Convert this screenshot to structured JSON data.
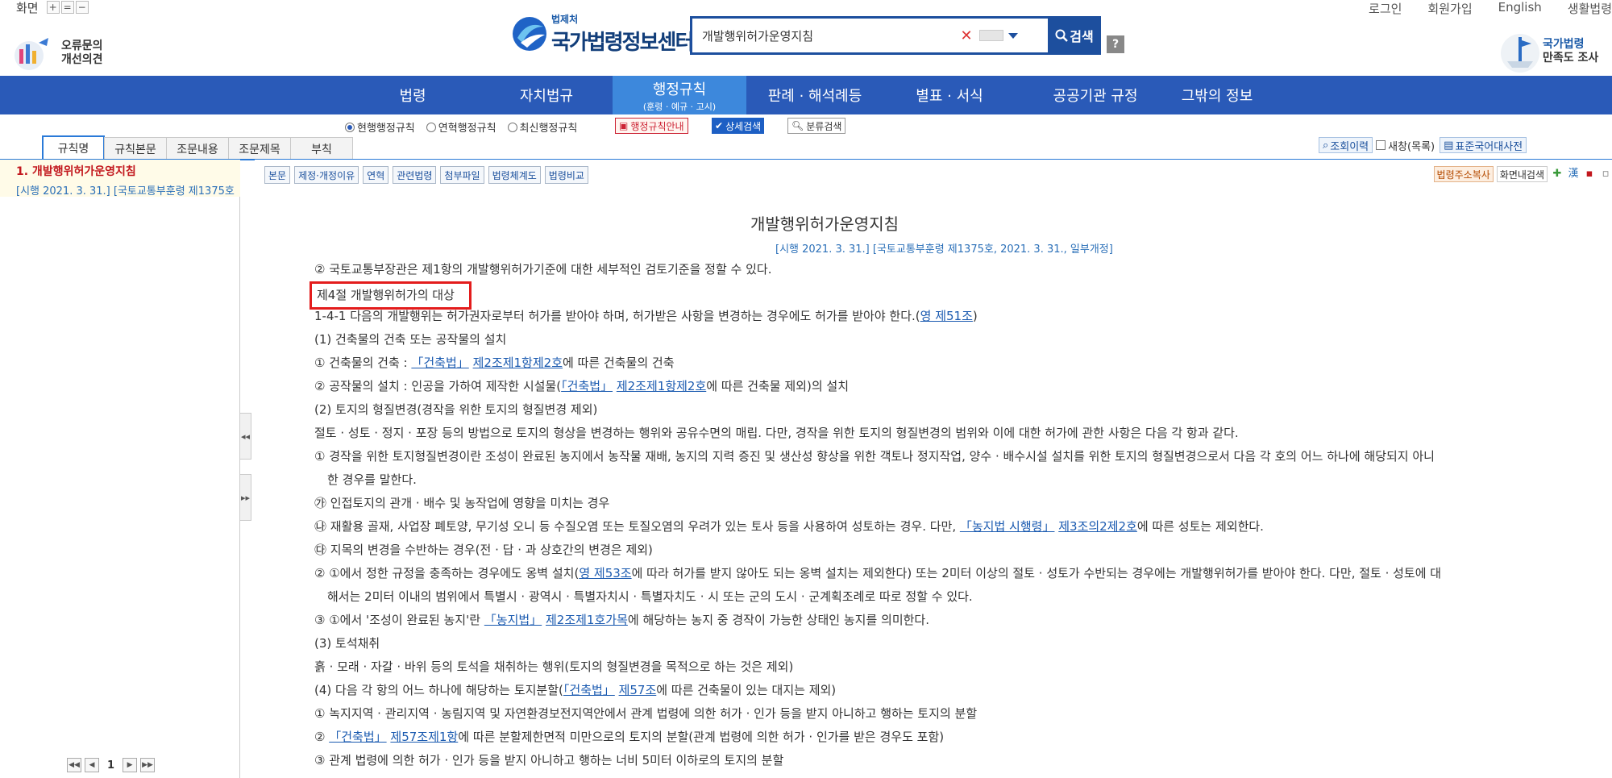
{
  "top": {
    "zoom_label": "화면",
    "zoom_plus": "+",
    "zoom_reset": "=",
    "zoom_minus": "−",
    "feedback_line1": "오류문의",
    "feedback_line2": "개선의견",
    "brand_sub": "법제처",
    "brand_main": "국가법령정보센터",
    "search_value": "개발행위허가운영지침",
    "search_button": "검색",
    "help": "?",
    "links": [
      "로그인",
      "회원가입",
      "English",
      "생활법령"
    ],
    "survey_line1": "국가법령",
    "survey_line2": "만족도 조사"
  },
  "nav": {
    "items": [
      "법령",
      "자치법규",
      "행정규칙",
      "판례 · 해석례등",
      "별표 · 서식",
      "공공기관 규정",
      "그밖의 정보"
    ],
    "active_sub": "(훈령 · 예규 · 고시)"
  },
  "subbar": {
    "radios": [
      "현행행정규칙",
      "연혁행정규칙",
      "최신행정규칙"
    ],
    "selected_radio": "현행행정규칙",
    "guide_button": "행정규칙안내",
    "detail_search": "상세검색",
    "category_search": "분류검색",
    "left_tabs": [
      "규칙명",
      "규칙본문",
      "조문내용",
      "조문제목",
      "부칙"
    ],
    "history": "조회이력",
    "new_window": "새창(목록)",
    "dictionary": "표준국어대사전"
  },
  "left": {
    "item_title": "1. 개발행위허가운영지침",
    "item_meta": "[시행 2021. 3. 31.] [국토교통부훈령 제1375호",
    "page": "1"
  },
  "toolbar": {
    "buttons": [
      "본문",
      "제정·개정이유",
      "연혁",
      "관련법령",
      "첨부파일",
      "법령체계도",
      "법령비교"
    ],
    "copy_address": "법령주소복사",
    "in_page_search": "화면내검색"
  },
  "doc": {
    "title": "개발행위허가운영지침",
    "meta": "[시행 2021. 3. 31.] [국토교통부훈령 제1375호, 2021. 3. 31., 일부개정]",
    "l01": "② 국토교통부장관은 제1항의 개발행위허가기준에 대한 세부적인 검토기준을 정할 수 있다.",
    "l02": "제4절 개발행위허가의 대상",
    "l03a": "1-4-1 다음의 개발행위는 허가권자로부터 허가를 받아야 하며, 허가받은 사항을 변경하는 경우에도 허가를 받아야 한다.(",
    "l03link": "영 제51조",
    "l03b": ")",
    "l04": "(1) 건축물의 건축 또는 공작물의 설치",
    "l05a": "① 건축물의 건축 : ",
    "l05link1": "「건축법」",
    "l05link2": "제2조제1항제2호",
    "l05b": "에 따른 건축물의 건축",
    "l06a": "② 공작물의 설치 : 인공을 가하여 제작한 시설물(",
    "l06link1": "「건축법」",
    "l06link2": "제2조제1항제2호",
    "l06b": "에 따른 건축물 제외)의 설치",
    "l07": "(2) 토지의 형질변경(경작을 위한 토지의 형질변경 제외)",
    "l08": "절토 · 성토 · 정지 · 포장 등의 방법으로 토지의 형상을 변경하는 행위와 공유수면의 매립. 다만, 경작을 위한 토지의 형질변경의 범위와 이에 대한 허가에 관한 사항은 다음 각 항과 같다.",
    "l09": "① 경작을 위한 토지형질변경이란 조성이 완료된 농지에서 농작물 재배, 농지의 지력 증진 및 생산성 향상을 위한 객토나 정지작업, 양수 · 배수시설 설치를 위한 토지의 형질변경으로서 다음 각 호의 어느 하나에 해당되지 아니",
    "l10": "한 경우를 말한다.",
    "l11": "㉮ 인접토지의 관개 · 배수 및 농작업에 영향을 미치는 경우",
    "l12a": "㉯ 재활용 골재, 사업장 폐토양, 무기성 오니 등 수질오염 또는 토질오염의 우려가 있는 토사 등을 사용하여 성토하는 경우. 다만, ",
    "l12link1": "「농지법 시행령」",
    "l12link2": "제3조의2제2호",
    "l12b": "에 따른 성토는 제외한다.",
    "l13": "㉰ 지목의 변경을 수반하는 경우(전 · 답 · 과 상호간의 변경은 제외)",
    "l14a": "② ①에서 정한 규정을 충족하는 경우에도 옹벽 설치(",
    "l14link": "영 제53조",
    "l14b": "에 따라 허가를 받지 않아도 되는 옹벽 설치는 제외한다) 또는 2미터 이상의 절토 · 성토가 수반되는 경우에는 개발행위허가를 받아야 한다. 다만, 절토 · 성토에 대",
    "l15": "해서는 2미터 이내의 범위에서 특별시 · 광역시 · 특별자치시 · 특별자치도 · 시 또는 군의 도시 · 군계획조례로 따로 정할 수 있다.",
    "l16a": "③ ①에서 '조성이 완료된 농지'란 ",
    "l16link1": "「농지법」",
    "l16link2": "제2조제1호가목",
    "l16b": "에 해당하는 농지 중 경작이 가능한 상태인 농지를 의미한다.",
    "l17": "(3) 토석채취",
    "l18": "흙 · 모래 · 자갈 · 바위 등의 토석을 채취하는 행위(토지의 형질변경을 목적으로 하는 것은 제외)",
    "l19a": "(4) 다음 각 항의 어느 하나에 해당하는 토지분할(",
    "l19link1": "「건축법」",
    "l19link2": "제57조",
    "l19b": "에 따른 건축물이 있는 대지는 제외)",
    "l20": "① 녹지지역 · 관리지역 · 농림지역 및 자연환경보전지역안에서 관계 법령에 의한 허가 · 인가 등을 받지 아니하고 행하는 토지의 분할",
    "l21a": "② ",
    "l21link1": "「건축법」",
    "l21link2": "제57조제1항",
    "l21b": "에 따른 분할제한면적 미만으로의 토지의 분할(관계 법령에 의한 허가 · 인가를 받은 경우도 포함)",
    "l22": "③ 관계 법령에 의한 허가 · 인가 등을 받지 아니하고 행하는 너비 5미터 이하로의 토지의 분할"
  },
  "colors": {
    "nav_bg": "#2a5ab8",
    "nav_active": "#3d88dc",
    "link": "#1a5ab0",
    "highlight_box": "#e31c1c",
    "left_item_title": "#c2171d"
  }
}
